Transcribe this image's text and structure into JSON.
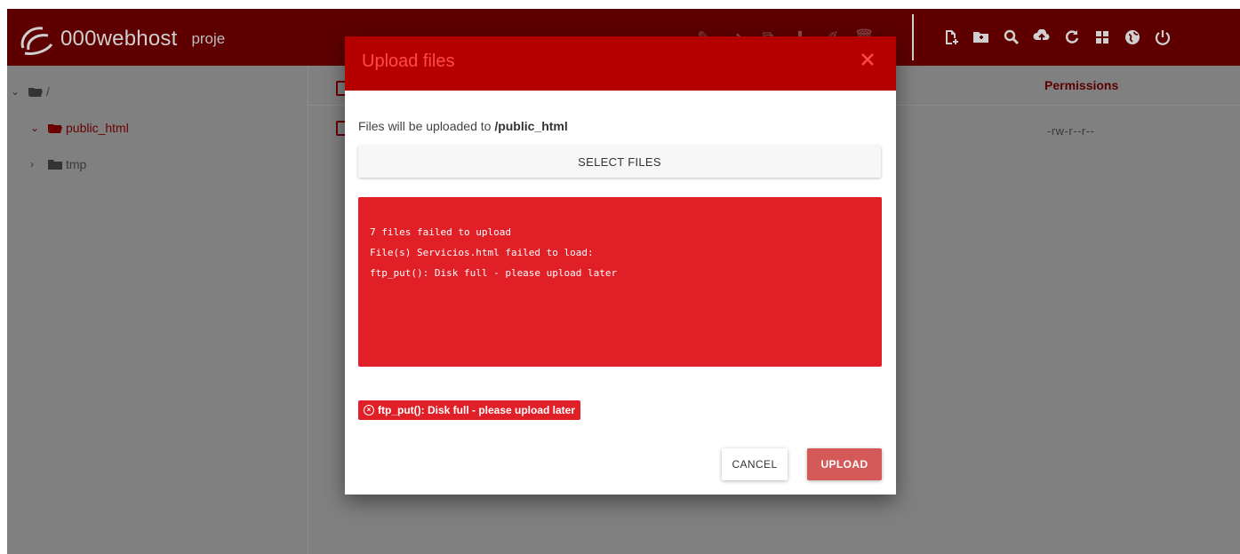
{
  "brand": {
    "name": "000webhost",
    "project": "proje"
  },
  "toolbar": {
    "faded_icons": [
      "edit-icon",
      "move-icon",
      "copy-icon",
      "download-icon",
      "rename-icon",
      "delete-icon"
    ],
    "icons": [
      "new-file-icon",
      "new-folder-icon",
      "search-icon",
      "upload-icon",
      "refresh-icon",
      "grid-icon",
      "globe-icon",
      "power-icon"
    ]
  },
  "tree": {
    "root": "/",
    "items": [
      {
        "label": "public_html",
        "expanded": true
      },
      {
        "label": "tmp",
        "expanded": false
      }
    ]
  },
  "table": {
    "permissions_header": "Permissions",
    "rows": [
      {
        "permissions": "-rw-r--r--"
      }
    ]
  },
  "modal": {
    "title": "Upload files",
    "dest_prefix": "Files will be uploaded to",
    "dest_path": "/public_html",
    "select_label": "SELECT FILES",
    "error_lines": [
      "7 files failed to upload",
      "File(s) Servicios.html failed to load:",
      "ftp_put(): Disk full - please upload later"
    ],
    "badge_text": "ftp_put(): Disk full - please upload later",
    "cancel_label": "CANCEL",
    "upload_label": "UPLOAD"
  },
  "colors": {
    "brand_dark": "#5e0000",
    "modal_header": "#b50000",
    "error": "#e01f27",
    "upload_button": "#d45a5a"
  }
}
